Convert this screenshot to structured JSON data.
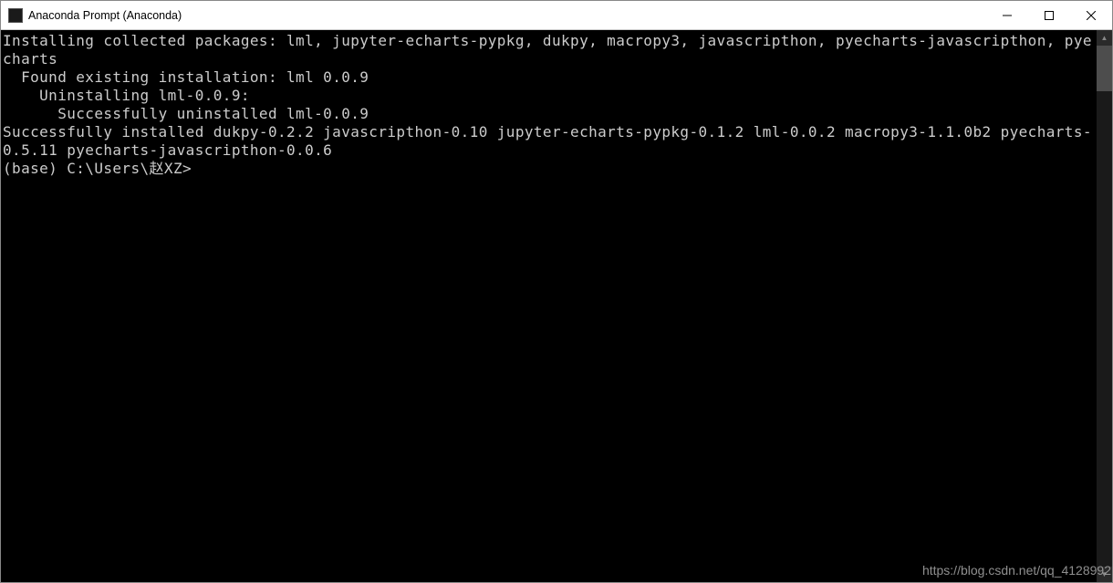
{
  "window": {
    "title": "Anaconda Prompt (Anaconda)"
  },
  "terminal": {
    "lines": [
      "Installing collected packages: lml, jupyter-echarts-pypkg, dukpy, macropy3, javascripthon, pyecharts-javascripthon, pyecharts",
      "  Found existing installation: lml 0.0.9",
      "    Uninstalling lml-0.0.9:",
      "      Successfully uninstalled lml-0.0.9",
      "Successfully installed dukpy-0.2.2 javascripthon-0.10 jupyter-echarts-pypkg-0.1.2 lml-0.0.2 macropy3-1.1.0b2 pyecharts-0.5.11 pyecharts-javascripthon-0.0.6",
      "",
      "(base) C:\\Users\\赵XZ>"
    ]
  },
  "watermark": "https://blog.csdn.net/qq_4128992"
}
